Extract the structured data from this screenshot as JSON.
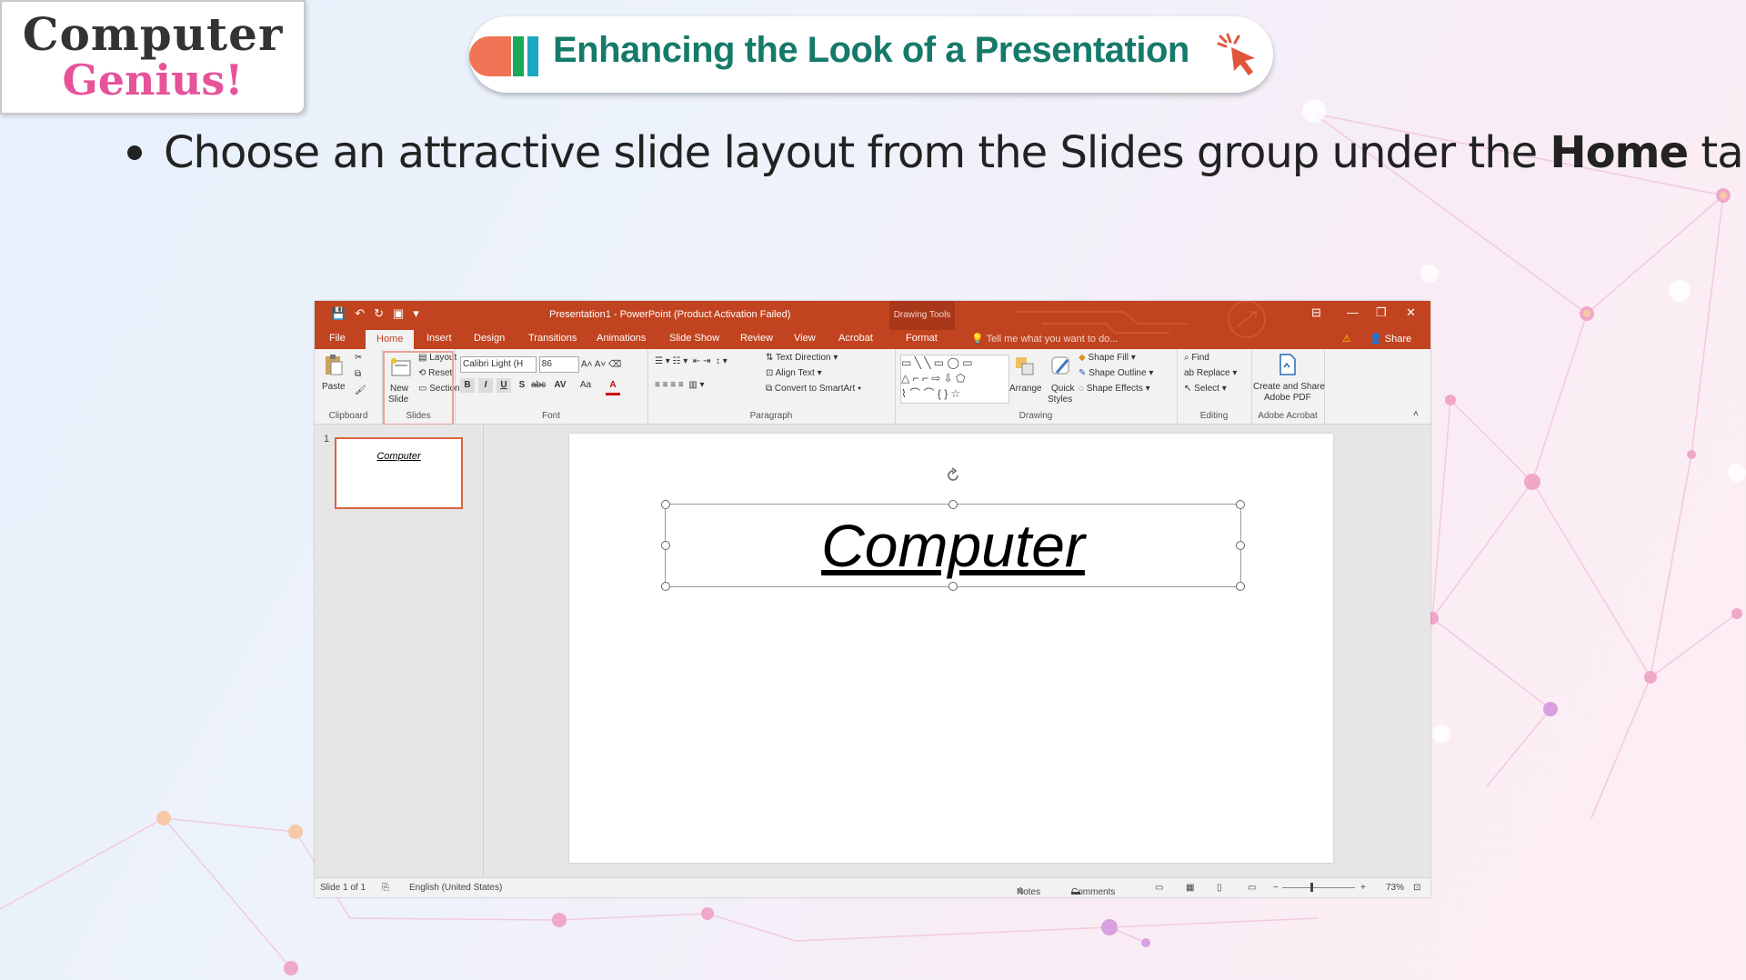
{
  "logo": {
    "line1": "Computer",
    "line2": "Genius!"
  },
  "title": "Enhancing the Look of a Presentation",
  "bullet": {
    "before": "Choose an attractive slide layout from the Slides group under the ",
    "bold": "Home",
    "after": " tab."
  },
  "ppt": {
    "window_title": "Presentation1 - PowerPoint (Product Activation Failed)",
    "contextual_tab": "Drawing Tools",
    "tabs": [
      "File",
      "Home",
      "Insert",
      "Design",
      "Transitions",
      "Animations",
      "Slide Show",
      "Review",
      "View",
      "Acrobat",
      "Format"
    ],
    "active_tab": "Home",
    "tell_me": "Tell me what you want to do...",
    "share": "Share",
    "ribbon": {
      "clipboard": {
        "paste": "Paste",
        "label": "Clipboard"
      },
      "slides": {
        "new_slide_1": "New",
        "new_slide_2": "Slide",
        "layout": "Layout",
        "reset": "Reset",
        "section": "Section",
        "label": "Slides"
      },
      "font": {
        "font_name": "Calibri Light (H",
        "font_size": "86",
        "label": "Font",
        "bold": "B",
        "italic": "I",
        "underline": "U",
        "shadow": "S",
        "strike": "abc",
        "spacing": "AV",
        "case": "Aa",
        "color": "A"
      },
      "paragraph": {
        "text_direction": "Text Direction",
        "align_text": "Align Text",
        "convert": "Convert to SmartArt",
        "label": "Paragraph"
      },
      "drawing": {
        "arrange": "Arrange",
        "quick_styles_1": "Quick",
        "quick_styles_2": "Styles",
        "shape_fill": "Shape Fill",
        "shape_outline": "Shape Outline",
        "shape_effects": "Shape Effects",
        "label": "Drawing"
      },
      "editing": {
        "find": "Find",
        "replace": "Replace",
        "select": "Select",
        "label": "Editing"
      },
      "acrobat": {
        "create_1": "Create and Share",
        "create_2": "Adobe PDF",
        "label": "Adobe Acrobat"
      }
    },
    "thumb_number": "1",
    "thumb_text": "Computer",
    "slide_text": "Computer",
    "status": {
      "slide": "Slide 1 of 1",
      "language": "English (United States)",
      "notes": "Notes",
      "comments": "Comments",
      "zoom": "73%"
    }
  },
  "colors": {
    "ppt_red": "#c1431f",
    "title_green": "#167a6a",
    "logo_pink": "#e6539a"
  }
}
